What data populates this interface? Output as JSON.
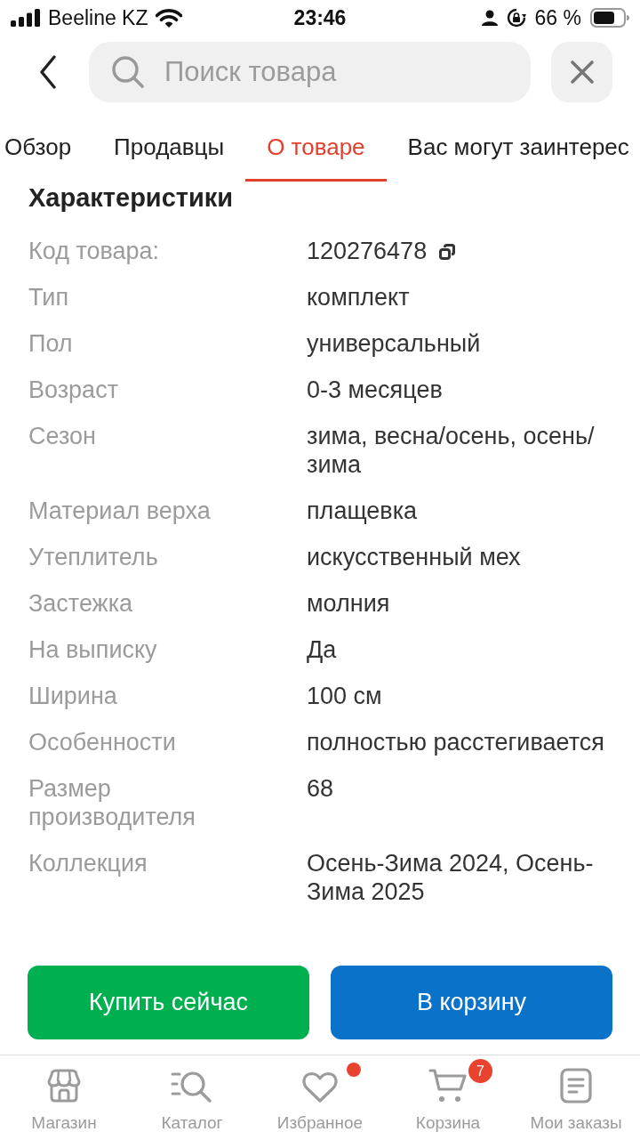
{
  "status_bar": {
    "carrier": "Beeline KZ",
    "time": "23:46",
    "battery_percent": "66 %"
  },
  "header": {
    "search": {
      "placeholder": "Поиск товара"
    }
  },
  "tabs": [
    {
      "label": "Обзор",
      "selected": false
    },
    {
      "label": "Продавцы",
      "selected": false
    },
    {
      "label": "О товаре",
      "selected": true
    },
    {
      "label": "Вас могут заинтерес",
      "selected": false
    }
  ],
  "section_title": "Характеристики",
  "specs": [
    {
      "label": "Код товара:",
      "value": "120276478",
      "copyable": true
    },
    {
      "label": "Тип",
      "value": "комплект",
      "copyable": false
    },
    {
      "label": "Пол",
      "value": "универсальный",
      "copyable": false
    },
    {
      "label": "Возраст",
      "value": "0-3 месяцев",
      "copyable": false
    },
    {
      "label": "Сезон",
      "value": "зима, весна/осень, осень/зима",
      "copyable": false
    },
    {
      "label": "Материал верха",
      "value": "плащевка",
      "copyable": false
    },
    {
      "label": "Утеплитель",
      "value": "искусственный мех",
      "copyable": false
    },
    {
      "label": "Застежка",
      "value": "молния",
      "copyable": false
    },
    {
      "label": "На выписку",
      "value": "Да",
      "copyable": false
    },
    {
      "label": "Ширина",
      "value": "100 см",
      "copyable": false
    },
    {
      "label": "Особенности",
      "value": "полностью расстегивается",
      "copyable": false
    },
    {
      "label": "Размер производителя",
      "value": "68",
      "copyable": false
    },
    {
      "label": "Коллекция",
      "value": "Осень-Зима 2024, Осень-Зима 2025",
      "copyable": false
    }
  ],
  "actions": [
    {
      "label": "Купить сейчас",
      "kind": "buy"
    },
    {
      "label": "В корзину",
      "kind": "cart"
    }
  ],
  "nav": [
    {
      "label": "Магазин",
      "selected": false,
      "notification_dot": false
    },
    {
      "label": "Каталог",
      "selected": false,
      "notification_dot": false
    },
    {
      "label": "Избранное",
      "selected": false,
      "notification_dot": true
    },
    {
      "label": "Корзина",
      "selected": false,
      "notification_dot": false,
      "badge": "7"
    },
    {
      "label": "Мои заказы",
      "selected": false,
      "notification_dot": false
    }
  ]
}
